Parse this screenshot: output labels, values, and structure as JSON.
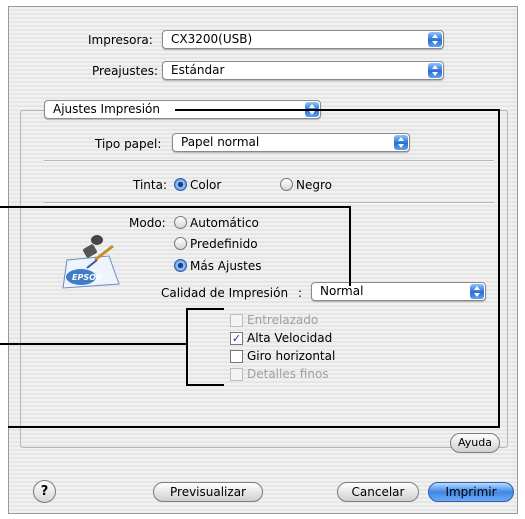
{
  "printer": {
    "label": "Impresora:",
    "value": "CX3200(USB)"
  },
  "presets": {
    "label": "Preajustes:",
    "value": "Estándar"
  },
  "panel_selector": {
    "value": "Ajustes Impresión"
  },
  "paper_type": {
    "label": "Tipo papel:",
    "value": "Papel normal"
  },
  "ink": {
    "label": "Tinta:",
    "options": [
      "Color",
      "Negro"
    ],
    "selected": "Color"
  },
  "mode": {
    "label": "Modo:",
    "options": [
      "Automático",
      "Predefinido",
      "Más Ajustes"
    ],
    "selected": "Más Ajustes"
  },
  "quality": {
    "label": "Calidad de Impresión",
    "separator": ":",
    "value": "Normal"
  },
  "options": [
    {
      "label": "Entrelazado",
      "checked": false,
      "enabled": false
    },
    {
      "label": "Alta Velocidad",
      "checked": true,
      "enabled": true
    },
    {
      "label": "Giro horizontal",
      "checked": false,
      "enabled": true
    },
    {
      "label": "Detalles finos",
      "checked": false,
      "enabled": false
    }
  ],
  "icon": {
    "name": "epson-brush-icon",
    "text": "EPSON"
  },
  "buttons": {
    "help": "Ayuda",
    "help_icon": "?",
    "preview": "Previsualizar",
    "cancel": "Cancelar",
    "print": "Imprimir"
  }
}
